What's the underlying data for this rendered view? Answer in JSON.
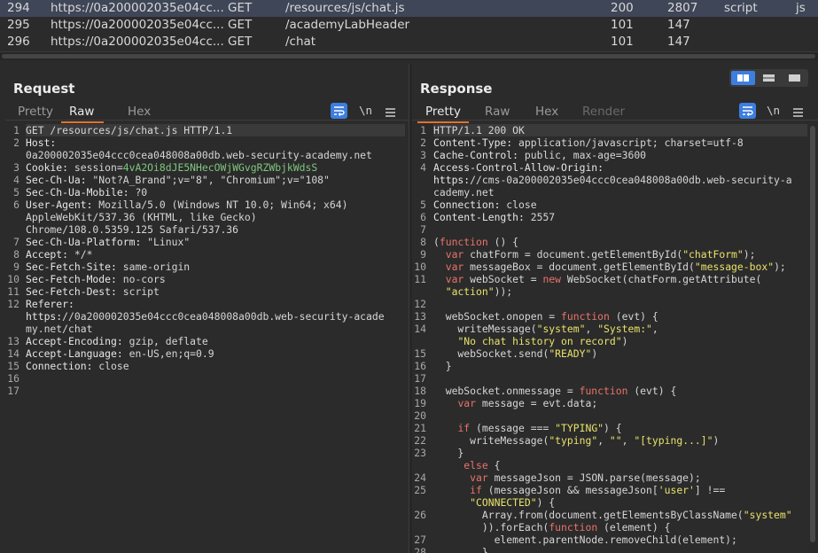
{
  "history": {
    "rows": [
      {
        "num": "294",
        "host": "https://0a200002035e04cc...",
        "method": "GET",
        "url": "/resources/js/chat.js",
        "status": "200",
        "length": "2807",
        "mime": "script",
        "ext": "js",
        "selected": true
      },
      {
        "num": "295",
        "host": "https://0a200002035e04cc...",
        "method": "GET",
        "url": "/academyLabHeader",
        "status": "101",
        "length": "147",
        "mime": "",
        "ext": "",
        "selected": false
      },
      {
        "num": "296",
        "host": "https://0a200002035e04cc...",
        "method": "GET",
        "url": "/chat",
        "status": "101",
        "length": "147",
        "mime": "",
        "ext": "",
        "selected": false
      }
    ]
  },
  "request": {
    "title": "Request",
    "tabs": [
      "Pretty",
      "Raw",
      "Hex"
    ],
    "active_tab": "Raw",
    "newline_label": "\\n",
    "gutter": [
      "1",
      "2",
      "",
      "3",
      "4",
      "5",
      "6",
      "",
      "",
      "7",
      "8",
      "9",
      "10",
      "11",
      "12",
      "",
      "",
      "13",
      "14",
      "15",
      "16",
      "17"
    ],
    "lines": [
      "GET /resources/js/chat.js HTTP/1.1",
      "Host:",
      "0a200002035e04ccc0cea048008a00db.web-security-academy.net",
      "Cookie: session=4vA2Oi8dJE5NHecOWjWGvgRZWbjkWdsS",
      "Sec-Ch-Ua: \"Not?A_Brand\";v=\"8\", \"Chromium\";v=\"108\"",
      "Sec-Ch-Ua-Mobile: ?0",
      "User-Agent: Mozilla/5.0 (Windows NT 10.0; Win64; x64)",
      "AppleWebKit/537.36 (KHTML, like Gecko)",
      "Chrome/108.0.5359.125 Safari/537.36",
      "Sec-Ch-Ua-Platform: \"Linux\"",
      "Accept: */*",
      "Sec-Fetch-Site: same-origin",
      "Sec-Fetch-Mode: no-cors",
      "Sec-Fetch-Dest: script",
      "Referer:",
      "https://0a200002035e04ccc0cea048008a00db.web-security-acade",
      "my.net/chat",
      "Accept-Encoding: gzip, deflate",
      "Accept-Language: en-US,en;q=0.9",
      "Connection: close",
      "",
      ""
    ]
  },
  "response": {
    "title": "Response",
    "tabs": [
      "Pretty",
      "Raw",
      "Hex",
      "Render"
    ],
    "active_tab": "Pretty",
    "newline_label": "\\n",
    "gutter": [
      "1",
      "2",
      "3",
      "4",
      "",
      "",
      "5",
      "6",
      "7",
      "8",
      "9",
      "10",
      "11",
      "",
      "12",
      "13",
      "14",
      "",
      "15",
      "16",
      "17",
      "18",
      "19",
      "20",
      "21",
      "22",
      "23",
      "",
      "24",
      "25",
      "",
      "26",
      "",
      "27",
      "28"
    ],
    "lines": [
      "HTTP/1.1 200 OK",
      "Content-Type: application/javascript; charset=utf-8",
      "Cache-Control: public, max-age=3600",
      "Access-Control-Allow-Origin:",
      "https://cms-0a200002035e04ccc0cea048008a00db.web-security-a",
      "cademy.net",
      "Connection: close",
      "Content-Length: 2557",
      "",
      "(function () {",
      "  var chatForm = document.getElementById(\"chatForm\");",
      "  var messageBox = document.getElementById(\"message-box\");",
      "  var webSocket = new WebSocket(chatForm.getAttribute(",
      "  \"action\"));",
      "",
      "  webSocket.onopen = function (evt) {",
      "    writeMessage(\"system\", \"System:\",",
      "    \"No chat history on record\")",
      "    webSocket.send(\"READY\")",
      "  }",
      "",
      "  webSocket.onmessage = function (evt) {",
      "    var message = evt.data;",
      "",
      "    if (message === \"TYPING\") {",
      "      writeMessage(\"typing\", \"\", \"[typing...]\")",
      "    }",
      "     else {",
      "      var messageJson = JSON.parse(message);",
      "      if (messageJson && messageJson['user'] !==",
      "      \"CONNECTED\") {",
      "        Array.from(document.getElementsByClassName(\"system\"",
      "        )).forEach(function (element) {",
      "          element.parentNode.removeChild(element);",
      "        }"
    ]
  },
  "colors": {
    "accent": "#e3722e",
    "toggle_active": "#3d7ee0",
    "selected_row": "#3f4658",
    "keyword": "#e8736a",
    "string": "#e8e26a",
    "cookie_value": "#7ec77e"
  }
}
